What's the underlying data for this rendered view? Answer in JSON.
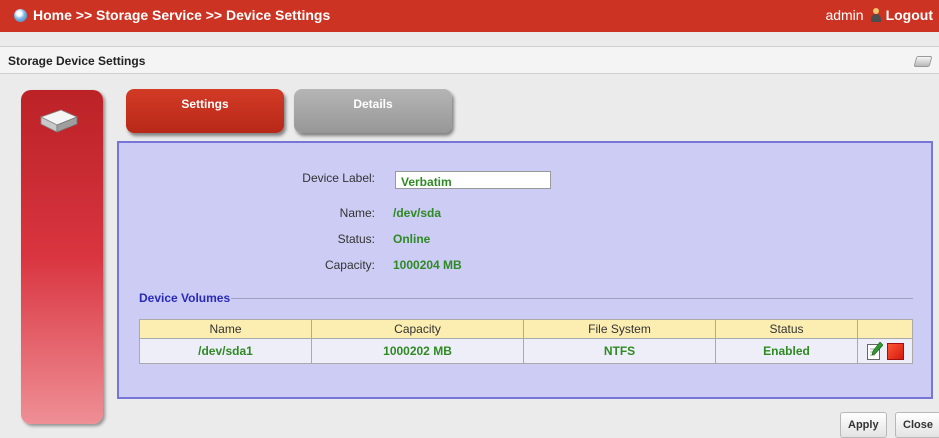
{
  "topbar": {
    "breadcrumb": "Home >> Storage Service >> Device Settings",
    "username": "admin",
    "logout_label": "Logout",
    "icons": {
      "home": "home-globe-icon",
      "user": "user-icon"
    },
    "bg_color": "#cc3322"
  },
  "page": {
    "title": "Storage Device Settings",
    "header_icon": "storage-device-icon"
  },
  "sidebar": {
    "icon": "hard-drive-icon"
  },
  "tabs": [
    {
      "label": "Settings",
      "active": true
    },
    {
      "label": "Details",
      "active": false
    }
  ],
  "device": {
    "label_caption": "Device Label:",
    "label_value": "Verbatim",
    "name_caption": "Name:",
    "name_value": "/dev/sda",
    "status_caption": "Status:",
    "status_value": "Online",
    "capacity_caption": "Capacity:",
    "capacity_value": "1000204 MB"
  },
  "volumes": {
    "title": "Device Volumes",
    "columns": [
      "Name",
      "Capacity",
      "File System",
      "Status"
    ],
    "rows": [
      {
        "name": "/dev/sda1",
        "capacity": "1000202 MB",
        "file_system": "NTFS",
        "status": "Enabled"
      }
    ],
    "row_actions": [
      "edit-icon",
      "delete-icon"
    ]
  },
  "buttons": {
    "apply": "Apply",
    "close": "Close"
  },
  "colors": {
    "accent_red": "#cc3322",
    "panel_bg": "#ccccf5",
    "panel_border": "#7676d8",
    "value_green": "#2e8a22"
  }
}
